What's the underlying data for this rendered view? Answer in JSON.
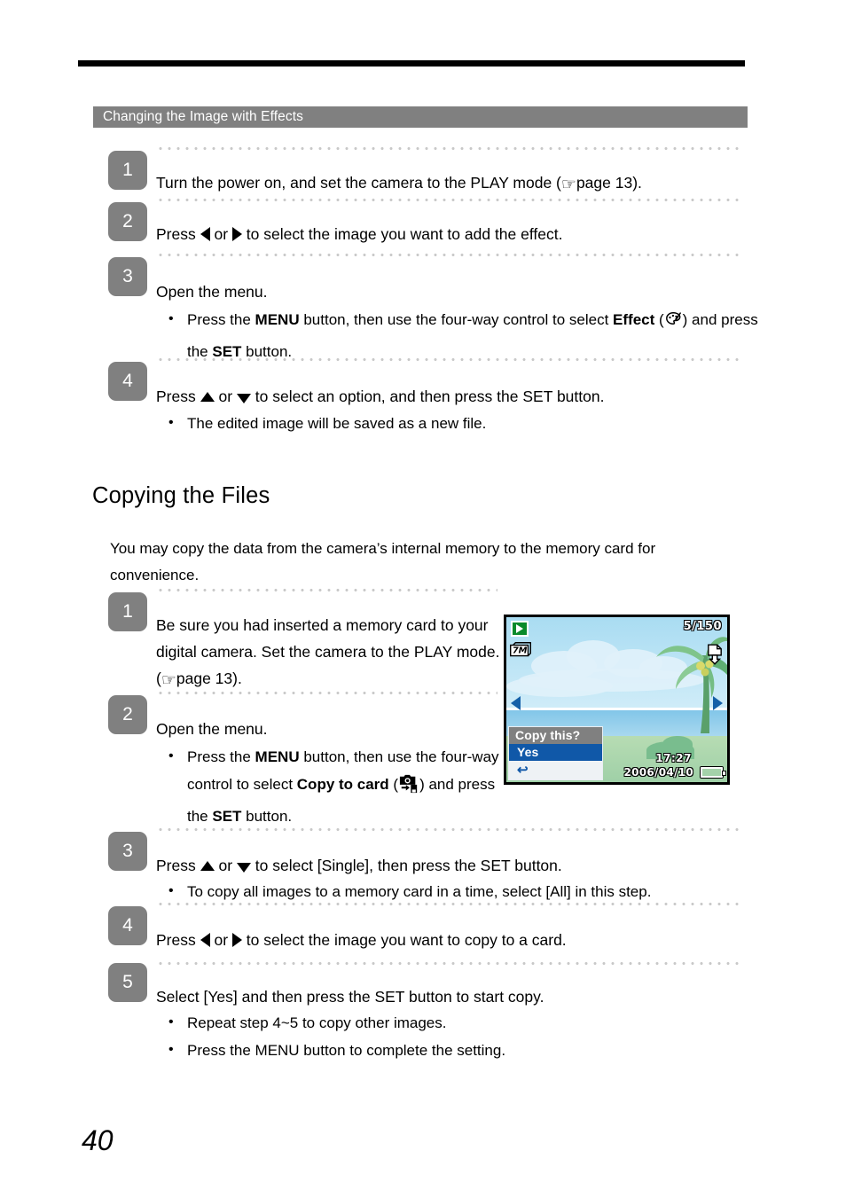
{
  "page": {
    "number": "40"
  },
  "section": {
    "title": "Changing the Image with Effects"
  },
  "effects_steps": [
    {
      "number": "1",
      "lead_a": "Turn the power on, and set the camera to the PLAY mode (",
      "lead_hand": "☞",
      "lead_b": "page 13)."
    },
    {
      "number": "2",
      "lead_a": "Press ",
      "lead_or": " or ",
      "lead_b": " to select the image you want to add the effect."
    },
    {
      "number": "3",
      "lead": "Open the menu.",
      "bullets": [
        {
          "part1": "Press the ",
          "bold1": "MENU",
          "part2": " button, then use the four-way control to select ",
          "bold2": "Effect",
          "part3": " (",
          "icon": "effect-palette-icon",
          "part4": ") and press the ",
          "bold3": "SET",
          "part5": " button."
        }
      ]
    },
    {
      "number": "4",
      "lead_a": "Press ",
      "lead_or": " or ",
      "lead_b": " to select an option, and then press the SET button.",
      "bullets": [
        {
          "text": "The edited image will be saved as a new file."
        }
      ]
    }
  ],
  "copying": {
    "heading": "Copying the Files",
    "intro": "You may copy the data from the camera’s internal memory to the memory card for convenience.",
    "steps": [
      {
        "number": "1",
        "lead_a": "Be sure you had inserted a memory card to your digital camera. Set the camera to the PLAY mode. (",
        "lead_hand": "☞",
        "lead_b": "page 13)."
      },
      {
        "number": "2",
        "lead": "Open the menu.",
        "bullets": [
          {
            "part1": "Press the ",
            "bold1": "MENU",
            "part2": " button, then use the four-way control to select ",
            "bold2": "Copy to card",
            "part3": " (",
            "icon": "copy-to-card-icon",
            "part4": ") and press the ",
            "bold3": "SET",
            "part5": " button."
          }
        ]
      },
      {
        "number": "3",
        "lead_a": "Press ",
        "lead_or": " or ",
        "lead_b": " to select [Single], then press the SET button.",
        "bullets": [
          {
            "text": "To copy all images to a memory card in a time, select [All] in this step."
          }
        ]
      },
      {
        "number": "4",
        "lead_a": "Press ",
        "lead_or": " or ",
        "lead_b": " to select the image you want to copy to a card."
      },
      {
        "number": "5",
        "lead": "Select [Yes] and then press the SET button to start copy.",
        "bullets": [
          {
            "text": "Repeat step 4~5 to copy other images."
          },
          {
            "text": "Press the MENU button to complete the setting."
          }
        ]
      }
    ]
  },
  "lcd": {
    "mode_icon": "play-mode-icon",
    "resolution_icon": "7m-resolution-icon",
    "frame_counter": "5/150",
    "card_icon": "copy-to-card-status-icon",
    "nav_left_icon": "nav-left-arrow-icon",
    "nav_right_icon": "nav-right-arrow-icon",
    "time": "17:27",
    "date": "2006/04/10",
    "battery_icon": "battery-icon",
    "dialog": {
      "title": "Copy this?",
      "selected_option": "Yes",
      "back_icon": "↩"
    }
  },
  "colors": {
    "section_bar": "#808080",
    "step_box": "#808080",
    "dotted_rule": "#c8c8c8",
    "lcd_dialog_title_bg": "#808080",
    "lcd_dialog_selected_bg": "#1058a8",
    "lcd_play_icon_bg": "#0a8a2a",
    "lcd_nav_arrow": "#1560a8"
  }
}
